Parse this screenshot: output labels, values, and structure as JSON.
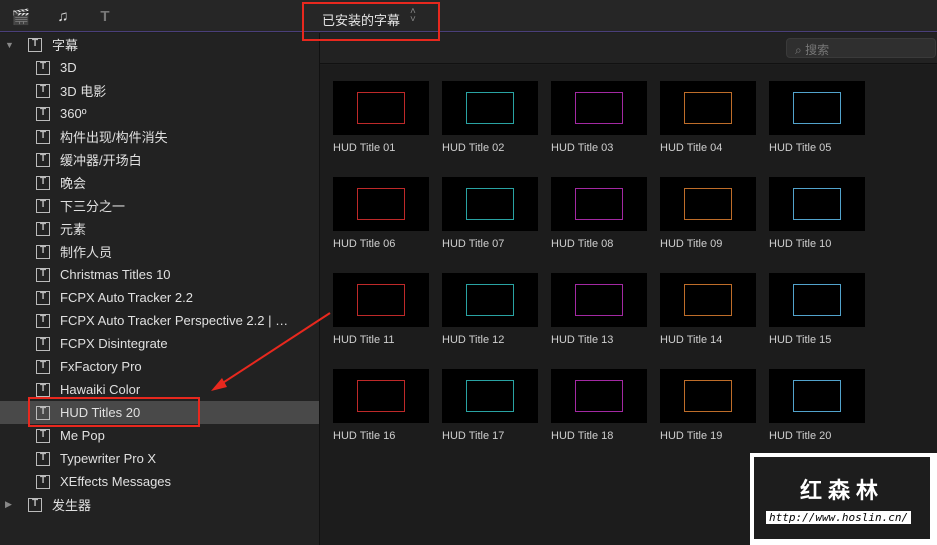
{
  "topbar": {
    "icons": [
      "clapper-star-icon",
      "music-photo-icon",
      "titles-generator-icon"
    ],
    "library_title": "已安装的字幕"
  },
  "sidebar": {
    "root": "字幕",
    "items": [
      "3D",
      "3D 电影",
      "360º",
      "构件出现/构件消失",
      "缓冲器/开场白",
      "晚会",
      "下三分之一",
      "元素",
      "制作人员",
      "Christmas Titles 10",
      "FCPX Auto Tracker 2.2",
      "FCPX Auto Tracker Perspective 2.2 | …",
      "FCPX Disintegrate",
      "FxFactory Pro",
      "Hawaiki Color",
      "HUD Titles 20",
      "Me Pop",
      "Typewriter Pro X",
      "XEffects Messages"
    ],
    "selected_index": 15,
    "generators": "发生器"
  },
  "search": {
    "placeholder": "搜索"
  },
  "grid": {
    "items": [
      "HUD Title 01",
      "HUD Title 02",
      "HUD Title 03",
      "HUD Title 04",
      "HUD Title 05",
      "HUD Title 06",
      "HUD Title 07",
      "HUD Title 08",
      "HUD Title 09",
      "HUD Title 10",
      "HUD Title 11",
      "HUD Title 12",
      "HUD Title 13",
      "HUD Title 14",
      "HUD Title 15",
      "HUD Title 16",
      "HUD Title 17",
      "HUD Title 18",
      "HUD Title 19",
      "HUD Title 20"
    ]
  },
  "watermark": {
    "name": "红森林",
    "url": "http://www.hoslin.cn/"
  },
  "colors": {
    "annotation": "#e8281e",
    "selection": "#494949"
  }
}
